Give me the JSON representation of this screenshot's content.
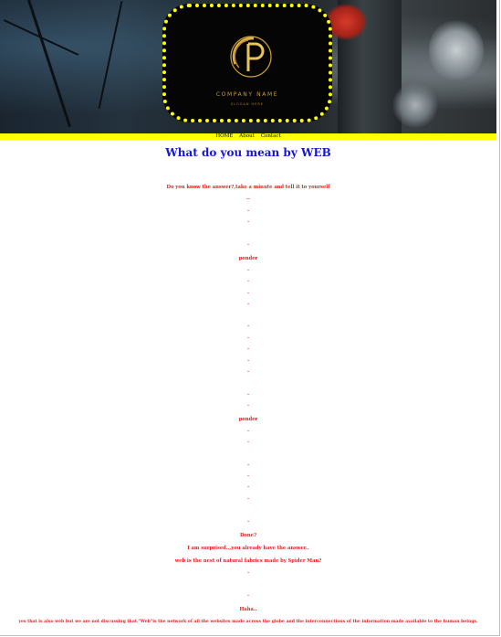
{
  "header": {
    "company_name": "COMPANY NAME",
    "slogan": "SLOGAN HERE",
    "colors": {
      "logo_border": "#ffff00",
      "logo_gold": "#c99b3a",
      "navbar_bg": "#ffff00"
    }
  },
  "nav": {
    "items": [
      {
        "label": "HOME"
      },
      {
        "label": "About"
      },
      {
        "label": "Contact"
      }
    ]
  },
  "content": {
    "title": "What do you mean by WEB",
    "question": "Do you know the answer?,take a minute and tell it to yourself",
    "pause1": "..",
    "dot": ".",
    "ponder1": "ponder",
    "ponder2": "ponder",
    "done": "Done?",
    "surprised": "I am surprised..,you already have the answer..",
    "spider": "web is the nest of natural fabrics made by Spider Man?",
    "haha": "Haha..",
    "conclusion": "yes that is also web but we are not discussing that.\"Web\"is the network of all the websites made across the globe and the interconnections of the information made available to the human beings.",
    "colors": {
      "title": "#1515d6",
      "text": "#e51c1c"
    }
  }
}
